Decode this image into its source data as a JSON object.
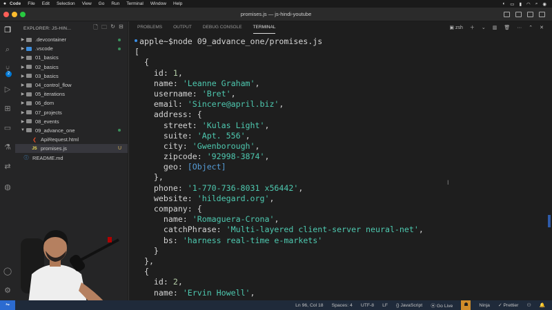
{
  "menubar": {
    "app": "Code",
    "items": [
      "File",
      "Edit",
      "Selection",
      "View",
      "Go",
      "Run",
      "Terminal",
      "Window",
      "Help"
    ]
  },
  "window": {
    "title": "promises.js — js-hindi-youtube"
  },
  "sidebar": {
    "header": "EXPLORER: JS-HIN...",
    "items": [
      {
        "label": ".devcontainer",
        "type": "folder"
      },
      {
        "label": ".vscode",
        "type": "folder-vscode"
      },
      {
        "label": "01_basics",
        "type": "folder"
      },
      {
        "label": "02_basics",
        "type": "folder"
      },
      {
        "label": "03_basics",
        "type": "folder"
      },
      {
        "label": "04_control_flow",
        "type": "folder"
      },
      {
        "label": "05_iterations",
        "type": "folder"
      },
      {
        "label": "06_dom",
        "type": "folder"
      },
      {
        "label": "07_projects",
        "type": "folder"
      },
      {
        "label": "08_events",
        "type": "folder"
      },
      {
        "label": "09_advance_one",
        "type": "folder-open"
      },
      {
        "label": "ApiRequest.html",
        "type": "html"
      },
      {
        "label": "promises.js",
        "type": "js",
        "status": "U"
      },
      {
        "label": "README.md",
        "type": "md"
      }
    ]
  },
  "panel": {
    "tabs": [
      "PROBLEMS",
      "OUTPUT",
      "DEBUG CONSOLE",
      "TERMINAL"
    ],
    "shell": "zsh"
  },
  "terminal": {
    "prompt": "apple~$node 09_advance_one/promises.js",
    "l01": "[",
    "l02": "  {",
    "l03_key": "    id: ",
    "l03_val": "1",
    "l03_end": ",",
    "l04_key": "    name: ",
    "l04_val": "'Leanne Graham'",
    "l04_end": ",",
    "l05_key": "    username: ",
    "l05_val": "'Bret'",
    "l05_end": ",",
    "l06_key": "    email: ",
    "l06_val": "'Sincere@april.biz'",
    "l06_end": ",",
    "l07": "    address: {",
    "l08_key": "      street: ",
    "l08_val": "'Kulas Light'",
    "l08_end": ",",
    "l09_key": "      suite: ",
    "l09_val": "'Apt. 556'",
    "l09_end": ",",
    "l10_key": "      city: ",
    "l10_val": "'Gwenborough'",
    "l10_end": ",",
    "l11_key": "      zipcode: ",
    "l11_val": "'92998-3874'",
    "l11_end": ",",
    "l12_key": "      geo: ",
    "l12_val": "[Object]",
    "l13": "    },",
    "l14_key": "    phone: ",
    "l14_val": "'1-770-736-8031 x56442'",
    "l14_end": ",",
    "l15_key": "    website: ",
    "l15_val": "'hildegard.org'",
    "l15_end": ",",
    "l16": "    company: {",
    "l17_key": "      name: ",
    "l17_val": "'Romaguera-Crona'",
    "l17_end": ",",
    "l18_key": "      catchPhrase: ",
    "l18_val": "'Multi-layered client-server neural-net'",
    "l18_end": ",",
    "l19_key": "      bs: ",
    "l19_val": "'harness real-time e-markets'",
    "l20": "    }",
    "l21": "  },",
    "l22": "  {",
    "l23_key": "    id: ",
    "l23_val": "2",
    "l23_end": ",",
    "l24_key": "    name: ",
    "l24_val": "'Ervin Howell'",
    "l24_end": ","
  },
  "statusbar": {
    "position": "Ln 96, Col 18",
    "spaces": "Spaces: 4",
    "encoding": "UTF-8",
    "eol": "LF",
    "language": "JavaScript",
    "golive": "Go Live",
    "ninja": "Ninja",
    "prettier": "Prettier"
  },
  "colors": {
    "string": "#4ec9b0",
    "number": "#b5cea8",
    "object": "#569cd6",
    "accent": "#0078d4"
  }
}
